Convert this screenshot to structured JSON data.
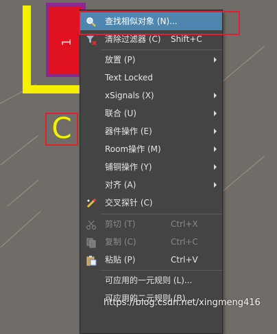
{
  "canvas": {
    "pad_number": "1",
    "designator": "C"
  },
  "menu": {
    "items": [
      {
        "label": "查找相似对象 (N)...",
        "shortcut": "",
        "submenu": false,
        "selected": true,
        "disabled": false,
        "icon": "find-similar-icon"
      },
      {
        "label": "清除过滤器 (C)",
        "shortcut": "Shift+C",
        "submenu": false,
        "selected": false,
        "disabled": false,
        "icon": "clear-filter-icon"
      },
      {
        "label": "放置 (P)",
        "shortcut": "",
        "submenu": true,
        "selected": false,
        "disabled": false,
        "icon": ""
      },
      {
        "label": "Text Locked",
        "shortcut": "",
        "submenu": false,
        "selected": false,
        "disabled": false,
        "icon": ""
      },
      {
        "label": "xSignals (X)",
        "shortcut": "",
        "submenu": true,
        "selected": false,
        "disabled": false,
        "icon": ""
      },
      {
        "label": "联合 (U)",
        "shortcut": "",
        "submenu": true,
        "selected": false,
        "disabled": false,
        "icon": ""
      },
      {
        "label": "器件操作 (E)",
        "shortcut": "",
        "submenu": true,
        "selected": false,
        "disabled": false,
        "icon": ""
      },
      {
        "label": "Room操作 (M)",
        "shortcut": "",
        "submenu": true,
        "selected": false,
        "disabled": false,
        "icon": ""
      },
      {
        "label": "铺铜操作 (Y)",
        "shortcut": "",
        "submenu": true,
        "selected": false,
        "disabled": false,
        "icon": ""
      },
      {
        "label": "对齐 (A)",
        "shortcut": "",
        "submenu": true,
        "selected": false,
        "disabled": false,
        "icon": ""
      },
      {
        "label": "交叉探针 (C)",
        "shortcut": "",
        "submenu": false,
        "selected": false,
        "disabled": false,
        "icon": "cross-probe-icon"
      },
      {
        "label": "剪切 (T)",
        "shortcut": "Ctrl+X",
        "submenu": false,
        "selected": false,
        "disabled": true,
        "icon": "cut-icon"
      },
      {
        "label": "复制 (C)",
        "shortcut": "Ctrl+C",
        "submenu": false,
        "selected": false,
        "disabled": true,
        "icon": "copy-icon"
      },
      {
        "label": "粘贴 (P)",
        "shortcut": "Ctrl+V",
        "submenu": false,
        "selected": false,
        "disabled": false,
        "icon": "paste-icon"
      },
      {
        "label": "可应用的一元规则 (L)...",
        "shortcut": "",
        "submenu": false,
        "selected": false,
        "disabled": false,
        "icon": ""
      },
      {
        "label": "可应用的二元规则 (B)...",
        "shortcut": "",
        "submenu": false,
        "selected": false,
        "disabled": false,
        "icon": ""
      }
    ]
  },
  "watermark": "https://blog.csdn.net/xingmeng416",
  "colors": {
    "canvas_bg": "#706c68",
    "silkscreen": "#f4f000",
    "pad": "#e01220",
    "menu_bg": "#444444",
    "menu_selected": "#4f86b0",
    "highlight_box": "#e02030"
  }
}
